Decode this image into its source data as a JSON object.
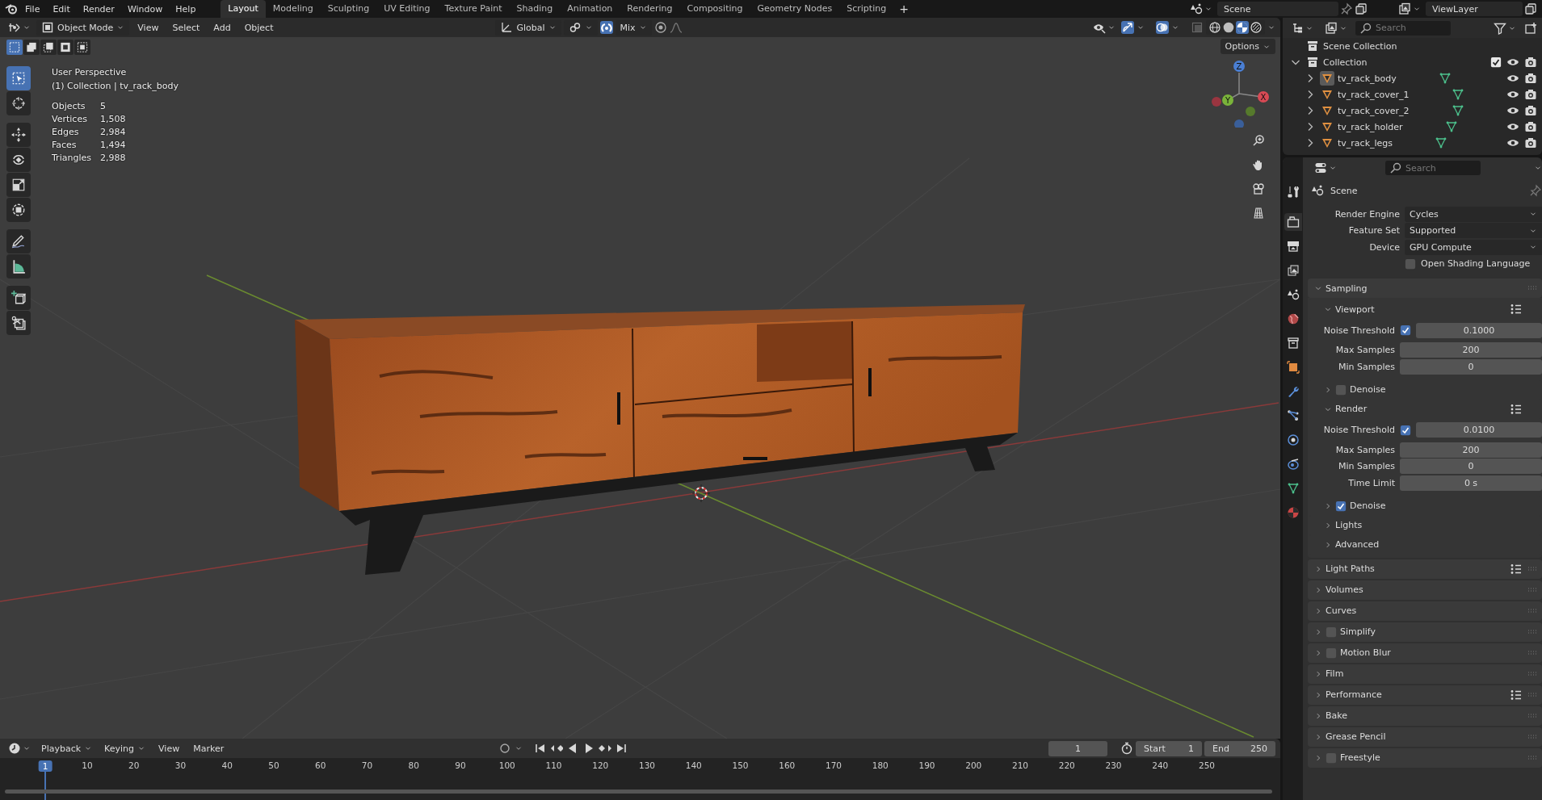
{
  "topbar": {
    "menus": [
      "File",
      "Edit",
      "Render",
      "Window",
      "Help"
    ],
    "workspaces": [
      {
        "label": "Layout",
        "selected": true
      },
      {
        "label": "Modeling",
        "selected": false
      },
      {
        "label": "Sculpting",
        "selected": false
      },
      {
        "label": "UV Editing",
        "selected": false
      },
      {
        "label": "Texture Paint",
        "selected": false
      },
      {
        "label": "Shading",
        "selected": false
      },
      {
        "label": "Animation",
        "selected": false
      },
      {
        "label": "Rendering",
        "selected": false
      },
      {
        "label": "Compositing",
        "selected": false
      },
      {
        "label": "Geometry Nodes",
        "selected": false
      },
      {
        "label": "Scripting",
        "selected": false
      }
    ],
    "add_tab": "+",
    "scene": "Scene",
    "view_layer": "ViewLayer"
  },
  "viewport": {
    "mode": "Object Mode",
    "menus": [
      "View",
      "Select",
      "Add",
      "Object"
    ],
    "orientation": "Global",
    "snap_on": true,
    "snap_target": "Mix",
    "gizmos_on": true,
    "overlays_on": true,
    "xray_on": false,
    "shading": [
      {
        "selected": false
      },
      {
        "selected": false
      },
      {
        "selected": true
      },
      {
        "selected": false
      }
    ],
    "select_modes": [
      {
        "selected": true
      },
      {
        "selected": false
      },
      {
        "selected": false
      },
      {
        "selected": false
      },
      {
        "selected": false
      }
    ],
    "options": "Options",
    "tools": [
      {
        "selected": true
      },
      {
        "selected": false
      },
      {
        "selected": false
      },
      {
        "selected": false
      },
      {
        "selected": false
      },
      {
        "selected": false
      },
      {
        "selected": false
      },
      {
        "selected": false
      },
      {
        "selected": false
      },
      {
        "selected": false
      }
    ],
    "view_name": "User Perspective",
    "context": "(1) Collection | tv_rack_body",
    "stats": [
      {
        "label": "Objects",
        "value": "5"
      },
      {
        "label": "Vertices",
        "value": "1,508"
      },
      {
        "label": "Edges",
        "value": "2,984"
      },
      {
        "label": "Faces",
        "value": "1,494"
      },
      {
        "label": "Triangles",
        "value": "2,988"
      }
    ],
    "gizmo_labels": [
      "Z",
      "Y",
      "X"
    ]
  },
  "outliner": {
    "search_placeholder": "Search",
    "tree": [
      {
        "kind": "scene_collection",
        "name": "Scene Collection",
        "children": [
          {
            "kind": "collection",
            "name": "Collection",
            "expanded": true,
            "included": true,
            "children": [
              {
                "kind": "mesh",
                "name": "tv_rack_body",
                "expanded": false,
                "selected": true
              },
              {
                "kind": "mesh",
                "name": "tv_rack_cover_1",
                "expanded": false,
                "selected": false
              },
              {
                "kind": "mesh",
                "name": "tv_rack_cover_2",
                "expanded": false,
                "selected": false
              },
              {
                "kind": "mesh",
                "name": "tv_rack_holder",
                "expanded": false,
                "selected": false
              },
              {
                "kind": "mesh",
                "name": "tv_rack_legs",
                "expanded": false,
                "selected": false
              }
            ]
          }
        ]
      }
    ]
  },
  "properties": {
    "search_placeholder": "Search",
    "context": "Scene",
    "tabs": [
      {
        "selected": false
      },
      {
        "selected": true
      },
      {
        "selected": false
      },
      {
        "selected": false
      },
      {
        "selected": false
      },
      {
        "selected": false
      },
      {
        "selected": false
      },
      {
        "selected": false
      },
      {
        "selected": false
      },
      {
        "selected": false
      },
      {
        "selected": false
      },
      {
        "selected": false
      },
      {
        "selected": false
      },
      {
        "selected": false
      }
    ],
    "settings": [
      {
        "kind": "dropdown",
        "label": "Render Engine",
        "value": "Cycles"
      },
      {
        "kind": "dropdown",
        "label": "Feature Set",
        "value": "Supported"
      },
      {
        "kind": "dropdown",
        "label": "Device",
        "value": "GPU Compute"
      },
      {
        "kind": "checkbox",
        "label": "Open Shading Language",
        "checked": false
      }
    ],
    "panels": [
      {
        "kind": "plain",
        "title": "Sampling",
        "expanded": true,
        "presets": false,
        "subpanels": [
          {
            "kind": "plain",
            "title": "Viewport",
            "expanded": true,
            "presets": true,
            "rows": [
              {
                "kind": "check_number",
                "label": "Noise Threshold",
                "checked": true,
                "value": "0.1000"
              },
              {
                "kind": "number",
                "label": "Max Samples",
                "value": "200"
              },
              {
                "kind": "number",
                "label": "Min Samples",
                "value": "0"
              }
            ]
          },
          {
            "kind": "toggle",
            "title": "Denoise",
            "checked": false,
            "expanded": false,
            "presets": false
          },
          {
            "kind": "plain",
            "title": "Render",
            "expanded": true,
            "presets": true,
            "rows": [
              {
                "kind": "check_number",
                "label": "Noise Threshold",
                "checked": true,
                "value": "0.0100"
              },
              {
                "kind": "number",
                "label": "Max Samples",
                "value": "200"
              },
              {
                "kind": "number",
                "label": "Min Samples",
                "value": "0"
              },
              {
                "kind": "number",
                "label": "Time Limit",
                "value": "0 s"
              }
            ]
          },
          {
            "kind": "toggle",
            "title": "Denoise",
            "checked": true,
            "expanded": false,
            "presets": false
          },
          {
            "kind": "plain",
            "title": "Lights",
            "expanded": false,
            "presets": false
          },
          {
            "kind": "plain",
            "title": "Advanced",
            "expanded": false,
            "presets": false
          }
        ]
      },
      {
        "kind": "plain",
        "title": "Light Paths",
        "expanded": false,
        "presets": true
      },
      {
        "kind": "plain",
        "title": "Volumes",
        "expanded": false,
        "presets": false
      },
      {
        "kind": "plain",
        "title": "Curves",
        "expanded": false,
        "presets": false
      },
      {
        "kind": "toggle",
        "title": "Simplify",
        "checked": false,
        "expanded": false,
        "presets": false
      },
      {
        "kind": "toggle",
        "title": "Motion Blur",
        "checked": false,
        "expanded": false,
        "presets": false
      },
      {
        "kind": "plain",
        "title": "Film",
        "expanded": false,
        "presets": false
      },
      {
        "kind": "plain",
        "title": "Performance",
        "expanded": false,
        "presets": true
      },
      {
        "kind": "plain",
        "title": "Bake",
        "expanded": false,
        "presets": false
      },
      {
        "kind": "plain",
        "title": "Grease Pencil",
        "expanded": false,
        "presets": false
      },
      {
        "kind": "toggle",
        "title": "Freestyle",
        "checked": false,
        "expanded": false,
        "presets": false
      }
    ]
  },
  "timeline": {
    "menus": [
      "Playback",
      "Keying",
      "View",
      "Marker"
    ],
    "current_frame": "1",
    "start_label": "Start",
    "start": "1",
    "end_label": "End",
    "end": "250",
    "ruler": [
      {
        "label": "1",
        "selected": true
      },
      {
        "label": "10",
        "selected": false
      },
      {
        "label": "20",
        "selected": false
      },
      {
        "label": "30",
        "selected": false
      },
      {
        "label": "40",
        "selected": false
      },
      {
        "label": "50",
        "selected": false
      },
      {
        "label": "60",
        "selected": false
      },
      {
        "label": "70",
        "selected": false
      },
      {
        "label": "80",
        "selected": false
      },
      {
        "label": "90",
        "selected": false
      },
      {
        "label": "100",
        "selected": false
      },
      {
        "label": "110",
        "selected": false
      },
      {
        "label": "120",
        "selected": false
      },
      {
        "label": "130",
        "selected": false
      },
      {
        "label": "140",
        "selected": false
      },
      {
        "label": "150",
        "selected": false
      },
      {
        "label": "160",
        "selected": false
      },
      {
        "label": "170",
        "selected": false
      },
      {
        "label": "180",
        "selected": false
      },
      {
        "label": "190",
        "selected": false
      },
      {
        "label": "200",
        "selected": false
      },
      {
        "label": "210",
        "selected": false
      },
      {
        "label": "220",
        "selected": false
      },
      {
        "label": "230",
        "selected": false
      },
      {
        "label": "240",
        "selected": false
      },
      {
        "label": "250",
        "selected": false
      }
    ]
  }
}
